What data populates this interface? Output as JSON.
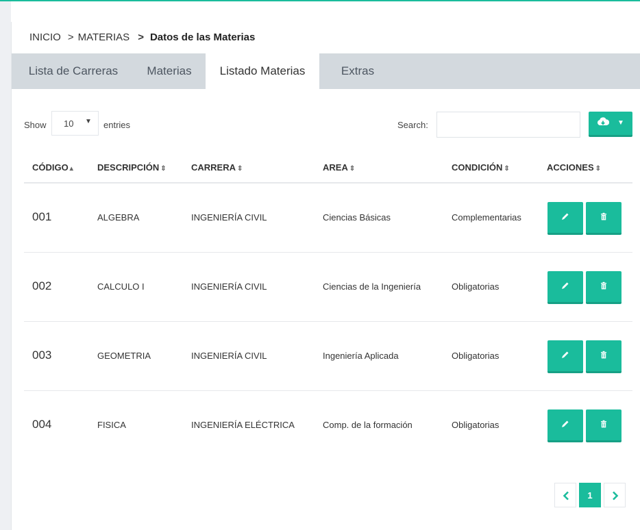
{
  "breadcrumb": {
    "home": "INICIO",
    "sep1": ">",
    "section": "MATERIAS",
    "sep2": ">",
    "current": "Datos de las Materias"
  },
  "tabs": [
    {
      "label": "Lista de Carreras",
      "active": false
    },
    {
      "label": "Materias",
      "active": false
    },
    {
      "label": "Listado Materias",
      "active": true
    },
    {
      "label": "Extras",
      "active": false
    }
  ],
  "controls": {
    "show_label": "Show",
    "length_value": "10",
    "entries_label": "entries",
    "search_label": "Search:",
    "search_value": "",
    "export_icon": "cloud-download-icon"
  },
  "table": {
    "columns": [
      "CÓDIGO",
      "DESCRIPCIÓN",
      "CARRERA",
      "AREA",
      "CONDICIÓN",
      "ACCIONES"
    ],
    "sort_icons": [
      "sort-asc-icon",
      "sort-icon",
      "sort-icon",
      "sort-icon",
      "sort-icon",
      "sort-icon"
    ],
    "rows": [
      {
        "codigo": "001",
        "descripcion": "ALGEBRA",
        "carrera": "INGENIERÍA CIVIL",
        "area": "Ciencias Básicas",
        "condicion": "Complementarias"
      },
      {
        "codigo": "002",
        "descripcion": "CALCULO I",
        "carrera": "INGENIERÍA CIVIL",
        "area": "Ciencias de la Ingeniería",
        "condicion": "Obligatorias"
      },
      {
        "codigo": "003",
        "descripcion": "GEOMETRIA",
        "carrera": "INGENIERÍA CIVIL",
        "area": "Ingeniería Aplicada",
        "condicion": "Obligatorias"
      },
      {
        "codigo": "004",
        "descripcion": "FISICA",
        "carrera": "INGENIERÍA ELÉCTRICA",
        "area": "Comp. de la formación",
        "condicion": "Obligatorias"
      }
    ],
    "action_icons": [
      "pencil-icon",
      "trash-icon"
    ]
  },
  "pagination": {
    "prev_icon": "chevron-left-icon",
    "current_page": "1",
    "next_icon": "chevron-right-icon"
  },
  "colors": {
    "accent": "#1abc9c",
    "accent_dark": "#16a085",
    "tab_bar": "#d3d9de"
  }
}
